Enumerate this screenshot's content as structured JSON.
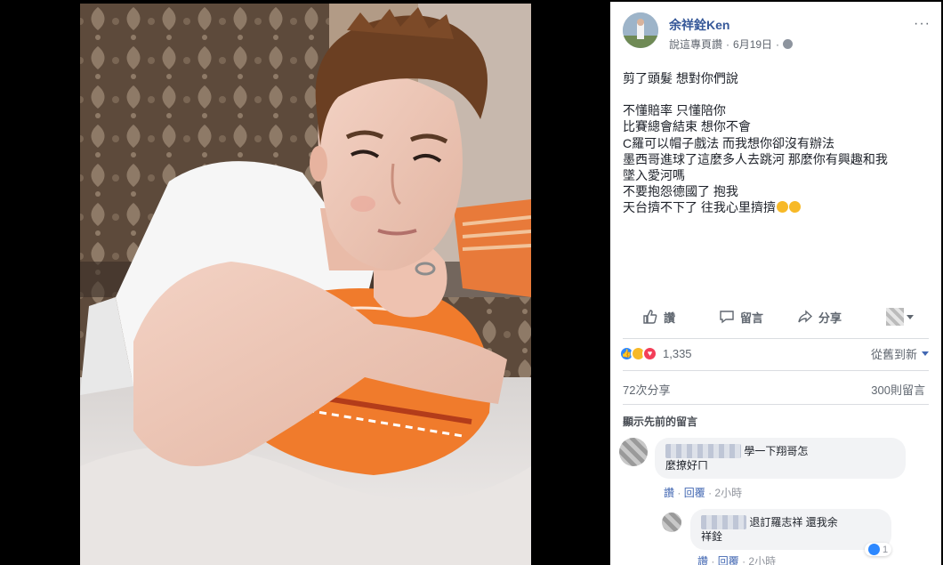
{
  "post": {
    "author": "余祥銓Ken",
    "audience_label": "說這專頁讚",
    "separator": "·",
    "date": "6月19日",
    "more_label": "···",
    "text_lines": [
      "剪了頭髮 想對你們說",
      "",
      "不懂賠率 只懂陪你",
      "比賽總會結束 想你不會",
      "C羅可以帽子戲法 而我想你卻沒有辦法",
      "墨西哥進球了這麼多人去跳河 那麼你有興趣和我",
      "墜入愛河嗎",
      "不要抱怨德國了 抱我",
      "天台擠不下了 往我心里擠擠"
    ]
  },
  "actions": {
    "like": "讚",
    "comment": "留言",
    "share": "分享"
  },
  "stats": {
    "reaction_count": "1,335",
    "sort_label": "從舊到新",
    "shares": "72次分享",
    "comments": "300則留言"
  },
  "comments": {
    "show_previous": "顯示先前的留言",
    "items": [
      {
        "name": "██████████",
        "text_line1": "學一下翔哥怎",
        "text_line2": "麼撩好ㄇ",
        "like": "讚",
        "reply": "回覆",
        "time": "2小時"
      },
      {
        "name": "██████",
        "text_line1": "退訂羅志祥 還我余",
        "text_line2": "祥銓",
        "like_count": "1",
        "like": "讚",
        "reply": "回覆",
        "time": "2小時"
      }
    ],
    "dot": "·"
  },
  "colors": {
    "link": "#365899",
    "muted": "#606770",
    "bubble": "#f2f3f5"
  }
}
